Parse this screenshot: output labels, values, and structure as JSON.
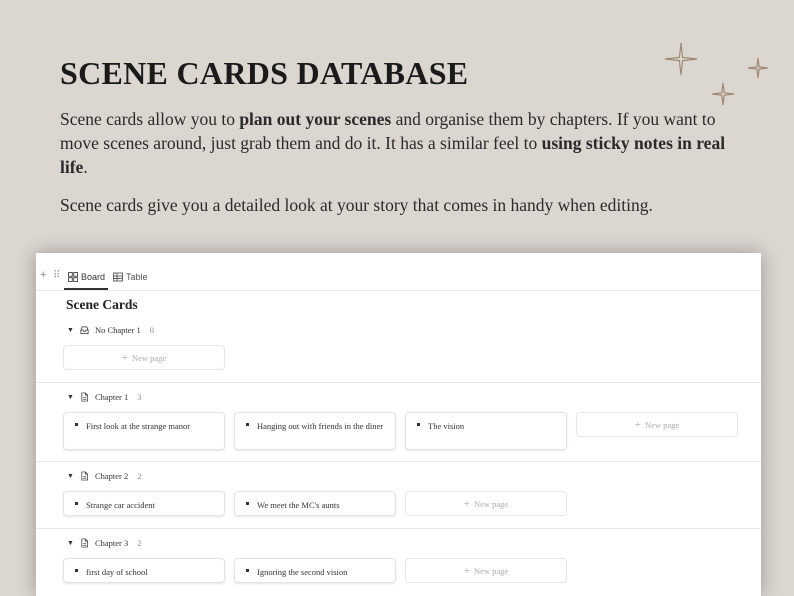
{
  "header": {
    "title": "SCENE CARDS DATABASE",
    "para1": {
      "t1": "Scene cards allow you to ",
      "b1": "plan out your scenes",
      "t2": " and organise them by chapters. If you want to move scenes around, just grab them and do it. It has a similar feel to ",
      "b2": "using sticky notes in real life",
      "t3": "."
    },
    "para2": "Scene cards give you a detailed look at your story that comes in handy when editing."
  },
  "colors": {
    "background": "#dcd6d1",
    "sparkle": "#a08a74"
  },
  "toolbar": {
    "tabs": [
      {
        "label": "Board",
        "icon": "board-icon",
        "active": true
      },
      {
        "label": "Table",
        "icon": "table-icon",
        "active": false
      }
    ]
  },
  "board": {
    "title": "Scene Cards",
    "new_page_label": "New page",
    "groups": [
      {
        "name": "No Chapter 1",
        "count": "0",
        "icon": "inbox-icon",
        "cards": []
      },
      {
        "name": "Chapter 1",
        "count": "3",
        "icon": "document-icon",
        "cards": [
          "First look at the strange manor",
          "Hanging out with friends in the diner",
          "The vision"
        ]
      },
      {
        "name": "Chapter 2",
        "count": "2",
        "icon": "document-icon",
        "cards": [
          "Strange car accident",
          "We meet the MC's aunts"
        ]
      },
      {
        "name": "Chapter 3",
        "count": "2",
        "icon": "document-icon",
        "cards": [
          "first day of school",
          "Ignoring the second vision"
        ]
      }
    ]
  }
}
